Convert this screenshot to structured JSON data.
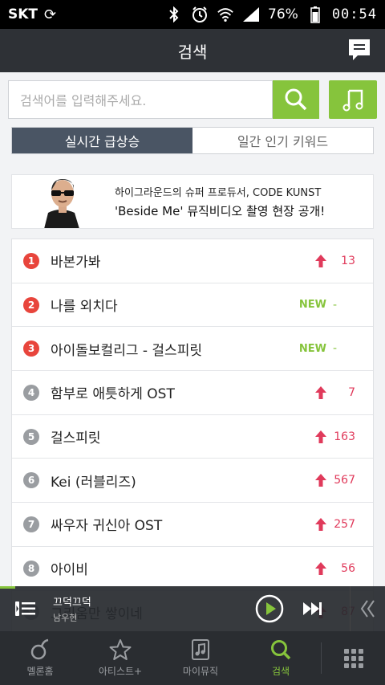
{
  "status": {
    "carrier": "SKT",
    "battery": "76%",
    "time": "00:54"
  },
  "header": {
    "title": "검색"
  },
  "search": {
    "placeholder": "검색어를 입력해주세요."
  },
  "tabs": [
    {
      "label": "실시간 급상승",
      "active": true
    },
    {
      "label": "일간 인기 키워드",
      "active": false
    }
  ],
  "banner": {
    "line1": "하이그라운드의 슈퍼 프로듀서, CODE KUNST",
    "line2": "'Beside Me' 뮤직비디오 촬영 현장 공개!"
  },
  "keywords": [
    {
      "rank": "1",
      "text": "바본가봐",
      "status": "up",
      "delta": "13"
    },
    {
      "rank": "2",
      "text": "나를 외치다",
      "status": "new",
      "new_label": "NEW",
      "delta": "-"
    },
    {
      "rank": "3",
      "text": "아이돌보컬리그 - 걸스피릿",
      "status": "new",
      "new_label": "NEW",
      "delta": "-"
    },
    {
      "rank": "4",
      "text": "함부로 애틋하게 OST",
      "status": "up",
      "delta": "7"
    },
    {
      "rank": "5",
      "text": "걸스피릿",
      "status": "up",
      "delta": "163"
    },
    {
      "rank": "6",
      "text": "Kei (러블리즈)",
      "status": "up",
      "delta": "567"
    },
    {
      "rank": "7",
      "text": "싸우자 귀신아 OST",
      "status": "up",
      "delta": "257"
    },
    {
      "rank": "8",
      "text": "아이비",
      "status": "up",
      "delta": "56"
    },
    {
      "rank": "9",
      "text": "그리움만 쌓이네",
      "status": "up",
      "delta": "87"
    }
  ],
  "player": {
    "song": "끄덕끄덕",
    "artist": "남우현",
    "progress": 0.04
  },
  "nav": [
    {
      "label": "멜론홈",
      "icon": "melon-note-icon",
      "active": false
    },
    {
      "label": "아티스트+",
      "icon": "star-icon",
      "active": false
    },
    {
      "label": "마이뮤직",
      "icon": "music-file-icon",
      "active": false
    },
    {
      "label": "검색",
      "icon": "search-icon",
      "active": true
    }
  ],
  "colors": {
    "accent": "#86c43c",
    "header": "#2e3136",
    "rank_top": "#e8453c",
    "rank_normal": "#9a9da1",
    "delta": "#e03a5b"
  }
}
